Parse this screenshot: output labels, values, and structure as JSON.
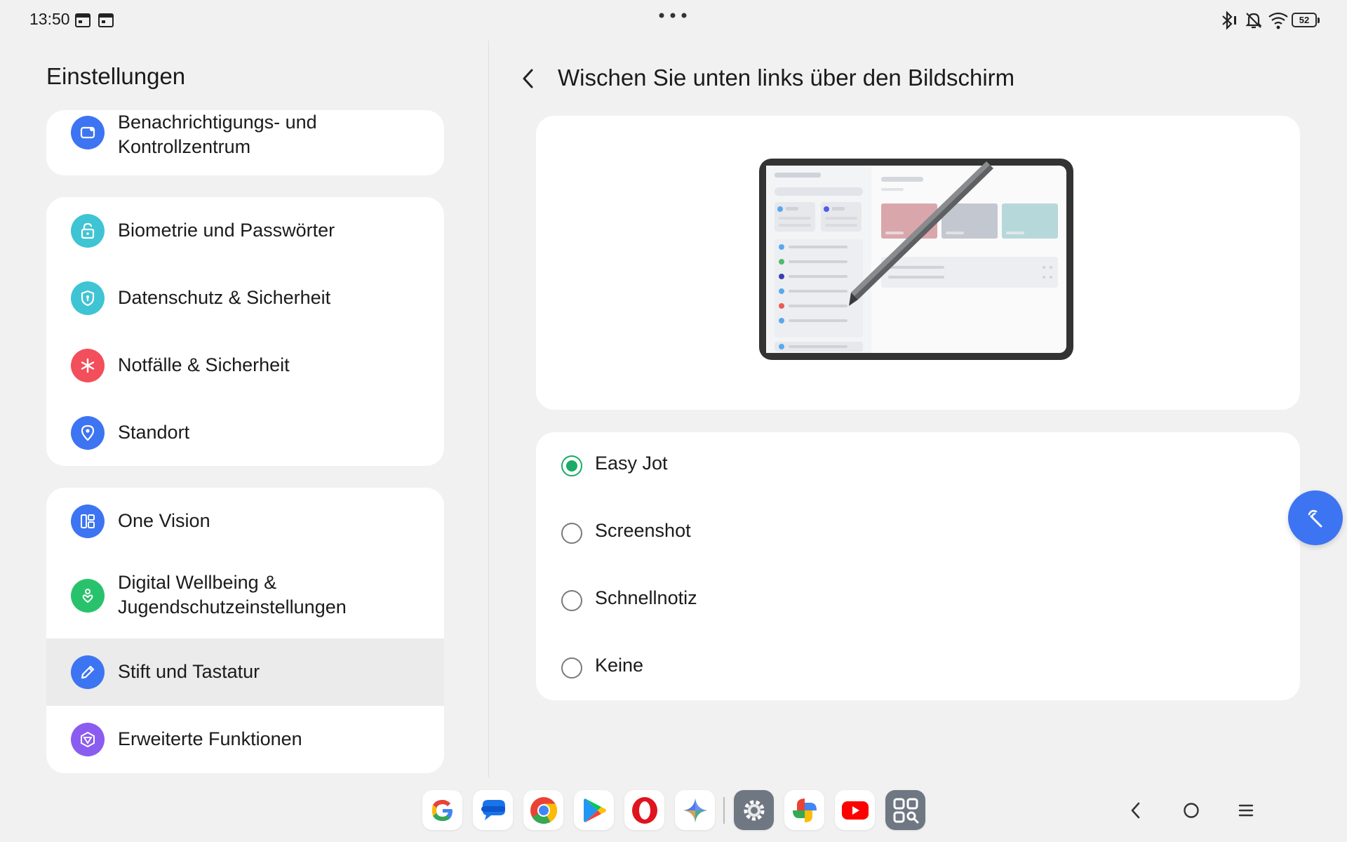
{
  "status_bar": {
    "time": "13:50",
    "battery": "52",
    "icons": [
      "calendar-icon",
      "calendar-icon",
      "more-dots-icon",
      "bluetooth-icon",
      "bell-muted-icon",
      "wifi-icon",
      "battery-icon"
    ]
  },
  "left": {
    "title": "Einstellungen",
    "items": [
      {
        "label": "Benachrichtigungs- und\nKontrollzentrum",
        "icon": "notification-icon",
        "color": "#3d74f2"
      },
      {
        "label": "Biometrie und Passwörter",
        "icon": "lock-icon",
        "color": "#3fc4d3"
      },
      {
        "label": "Datenschutz & Sicherheit",
        "icon": "shield-icon",
        "color": "#3fc4d3"
      },
      {
        "label": "Notfälle & Sicherheit",
        "icon": "asterisk-icon",
        "color": "#f24e5b"
      },
      {
        "label": "Standort",
        "icon": "location-icon",
        "color": "#3d74f2"
      },
      {
        "label": "One Vision",
        "icon": "grid-icon",
        "color": "#3d74f2"
      },
      {
        "label": "Digital Wellbeing &\nJugendschutzeinstellungen",
        "icon": "wellbeing-icon",
        "color": "#29c26c"
      },
      {
        "label": "Stift und Tastatur",
        "icon": "pen-icon",
        "color": "#3d74f2"
      },
      {
        "label": "Erweiterte Funktionen",
        "icon": "cube-icon",
        "color": "#8b5cf0"
      }
    ]
  },
  "right": {
    "title": "Wischen Sie unten links über den Bildschirm",
    "options": [
      {
        "label": "Easy Jot",
        "checked": true
      },
      {
        "label": "Screenshot",
        "checked": false
      },
      {
        "label": "Schnellnotiz",
        "checked": false
      },
      {
        "label": "Keine",
        "checked": false
      }
    ]
  },
  "dock": {
    "apps": [
      "google-icon",
      "messages-icon",
      "chrome-icon",
      "play-store-icon",
      "opera-icon",
      "gemini-icon",
      "settings-icon",
      "photos-icon",
      "youtube-icon",
      "scanner-icon"
    ]
  },
  "colors": {
    "accent": "#3d74f2",
    "radio_checked": "#1aab66",
    "background": "#f1f1f1",
    "card": "#ffffff"
  }
}
